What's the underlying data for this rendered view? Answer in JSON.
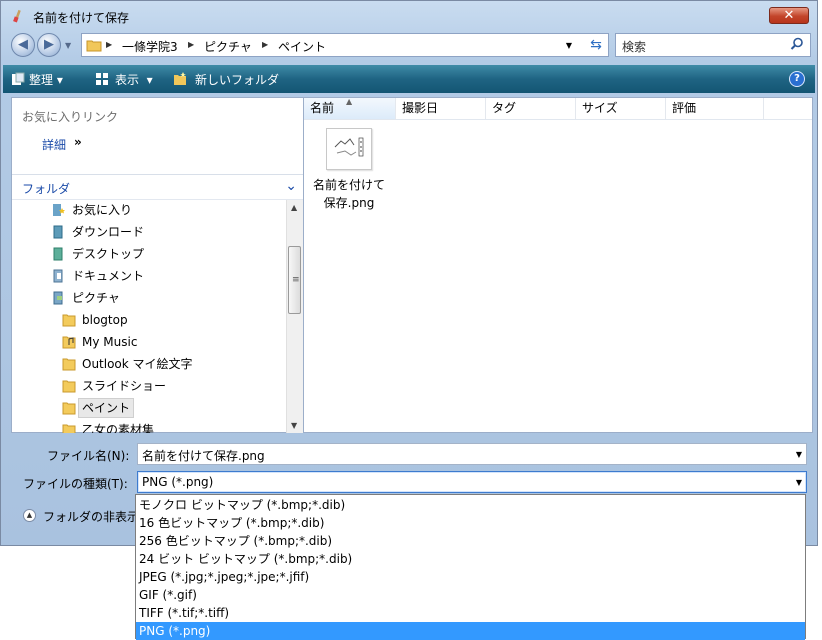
{
  "window": {
    "title": "名前を付けて保存",
    "close_glyph": "✕"
  },
  "address_bar": {
    "breadcrumbs": [
      "一條学院3",
      "ピクチャ",
      "ペイント"
    ],
    "search_placeholder": "検索"
  },
  "toolbar": {
    "organize": "整理",
    "views": "表示",
    "new_folder": "新しいフォルダ",
    "help_glyph": "?"
  },
  "left_pane": {
    "favorites_header": "お気に入りリンク",
    "details_link": "詳細",
    "details_chevron": "»",
    "folders_label": "フォルダ",
    "tree": [
      {
        "label": "お気に入り",
        "icon": "favorites-icon"
      },
      {
        "label": "ダウンロード",
        "icon": "downloads-folder-icon"
      },
      {
        "label": "デスクトップ",
        "icon": "desktop-folder-icon"
      },
      {
        "label": "ドキュメント",
        "icon": "documents-folder-icon"
      },
      {
        "label": "ピクチャ",
        "icon": "pictures-folder-icon"
      },
      {
        "label": "blogtop",
        "icon": "folder-icon"
      },
      {
        "label": "My Music",
        "icon": "music-folder-icon"
      },
      {
        "label": "Outlook マイ絵文字",
        "icon": "folder-icon"
      },
      {
        "label": "スライドショー",
        "icon": "folder-icon"
      },
      {
        "label": "ペイント",
        "icon": "folder-icon",
        "selected": true
      },
      {
        "label": "乙女の素材集",
        "icon": "folder-icon"
      }
    ]
  },
  "file_list": {
    "columns": [
      "名前",
      "撮影日",
      "タグ",
      "サイズ",
      "評価"
    ],
    "sorted_column": "名前",
    "files": [
      {
        "name_line1": "名前を付けて",
        "name_line2": "保存.png"
      }
    ]
  },
  "form": {
    "filename_label": "ファイル名(N):",
    "filename_value": "名前を付けて保存.png",
    "filetype_label": "ファイルの種類(T):",
    "filetype_value": "PNG (*.png)",
    "hide_folders_label": "フォルダの非表示"
  },
  "filetype_options": [
    "モノクロ ビットマップ (*.bmp;*.dib)",
    "16 色ビットマップ (*.bmp;*.dib)",
    "256 色ビットマップ (*.bmp;*.dib)",
    "24 ビット ビットマップ (*.bmp;*.dib)",
    "JPEG (*.jpg;*.jpeg;*.jpe;*.jfif)",
    "GIF (*.gif)",
    "TIFF (*.tif;*.tiff)",
    "PNG (*.png)"
  ],
  "selected_option_index": 7,
  "colors": {
    "toolbar": "#1f6483",
    "selection": "#3399ff",
    "link": "#1a4aa8"
  }
}
